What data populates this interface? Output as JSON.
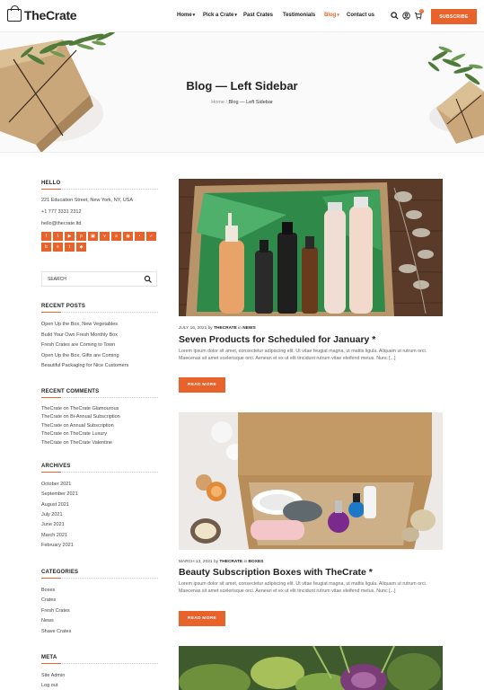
{
  "brand": {
    "name_prefix": "The",
    "name_suffix": "Crate"
  },
  "nav": {
    "items": [
      {
        "label": "Home",
        "has_dropdown": true
      },
      {
        "label": "Pick a Crate",
        "has_dropdown": true
      },
      {
        "label": "Past Crates",
        "has_dropdown": false
      },
      {
        "label": "Testimonials",
        "has_dropdown": false
      },
      {
        "label": "Blog",
        "has_dropdown": true,
        "active": true
      },
      {
        "label": "Contact us",
        "has_dropdown": false
      }
    ],
    "cart_count": "0",
    "subscribe_label": "SUBSCRIBE",
    "icons": [
      "search-icon",
      "user-icon",
      "cart-icon"
    ]
  },
  "hero": {
    "title": "Blog — Left Sidebar",
    "crumb_home": "Home",
    "crumb_sep": "/",
    "crumb_current": "Blog — Left Sidebar"
  },
  "sidebar": {
    "hello": {
      "title": "HELLO",
      "address": "221 Education Street, New York, NY, USA",
      "phone": "+1 777 3331 2312",
      "email": "hello@thecrate.ltd",
      "social_icons": [
        "facebook-icon",
        "twitter-icon",
        "youtube-icon",
        "pinterest-icon",
        "instagram-icon",
        "vimeo-icon",
        "skype-icon",
        "dribbble-icon",
        "flickr-icon",
        "foursquare-icon",
        "behance-icon",
        "stackoverflow-icon",
        "tumblr-icon",
        "vk-icon"
      ]
    },
    "search": {
      "placeholder": "SEARCH"
    },
    "recent_posts": {
      "title": "RECENT POSTS",
      "items": [
        "Open Up the Box, New Vegetables",
        "Build Your Own Fresh Monthly Box",
        "Fresh Crates are Coming to Town",
        "Open Up the Box, Gifts are Coming",
        "Beautiful Packaging for Nice Customers"
      ]
    },
    "recent_comments": {
      "title": "RECENT COMMENTS",
      "items": [
        "TheCrate on TheCrate Glamourous",
        "TheCrate on Bi-Annual Subscription",
        "TheCrate on Annual Subscription",
        "TheCrate on TheCrate Luxury",
        "TheCrate on TheCrate Valentine"
      ]
    },
    "archives": {
      "title": "ARCHIVES",
      "items": [
        "October 2021",
        "September 2021",
        "August 2021",
        "July 2021",
        "June 2021",
        "March 2021",
        "February 2021"
      ]
    },
    "categories": {
      "title": "CATEGORIES",
      "items": [
        "Boxes",
        "Crates",
        "Fresh Crates",
        "News",
        "Shave Crates"
      ]
    },
    "meta": {
      "title": "META",
      "items": [
        "Site Admin",
        "Log out"
      ]
    }
  },
  "posts": [
    {
      "date": "JULY 16, 2021",
      "by": "by",
      "author": "THECRATE",
      "in": "in",
      "category": "NEWS",
      "title": "Seven Products for Scheduled for January *",
      "excerpt": "Lorem ipsum dolor sit amet, consectetur adipiscing elit. Ut vitae feugiat magna, ut mattis ligula. Aliquam ut rutrum orci. Maecenas sit amet scelerisque orci. Aenean et ex ut elit tincidunt rutrum vitae eleifend metus. Nunc [...]",
      "read_more": "READ MORE"
    },
    {
      "date": "MARCH 13, 2021",
      "by": "by",
      "author": "THECRATE",
      "in": "in",
      "category": "BOXES",
      "title": "Beauty Subscription Boxes with TheCrate *",
      "excerpt": "Lorem ipsum dolor sit amet, consectetur adipiscing elit. Ut vitae feugiat magna, ut mattis ligula. Aliquam ut rutrum orci. Maecenas sit amet scelerisque orci. Aenean et ex ut elit tincidunt rutrum vitae eleifend metus. Nunc [...]",
      "read_more": "READ MORE"
    }
  ],
  "colors": {
    "accent": "#e8622c",
    "text": "#222222",
    "muted": "#666666"
  }
}
